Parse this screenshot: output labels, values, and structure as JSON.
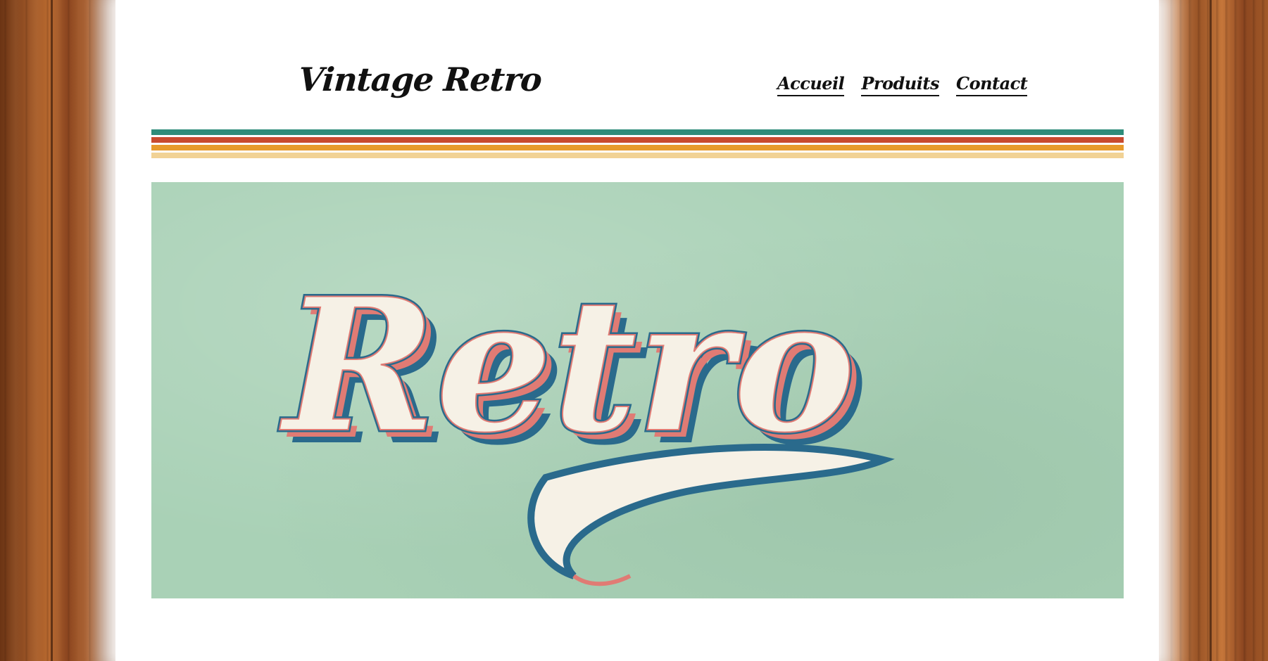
{
  "site": {
    "logo_text": "Vintage Retro"
  },
  "nav": {
    "items": [
      {
        "label": "Accueil"
      },
      {
        "label": "Produits"
      },
      {
        "label": "Contact"
      }
    ]
  },
  "stripes": {
    "colors": [
      "#2e8c7a",
      "#c84a2e",
      "#e79a2b",
      "#f1d295"
    ]
  },
  "hero": {
    "banner_text": "Retro",
    "background_color": "#a9d1b6",
    "text_fill_color": "#f6f1e6",
    "shadow_pink_color": "#e07b74",
    "outline_blue_color": "#2a6a8c"
  },
  "colors": {
    "page_background": "#ffffff",
    "wood_brown": "#9a5426"
  }
}
